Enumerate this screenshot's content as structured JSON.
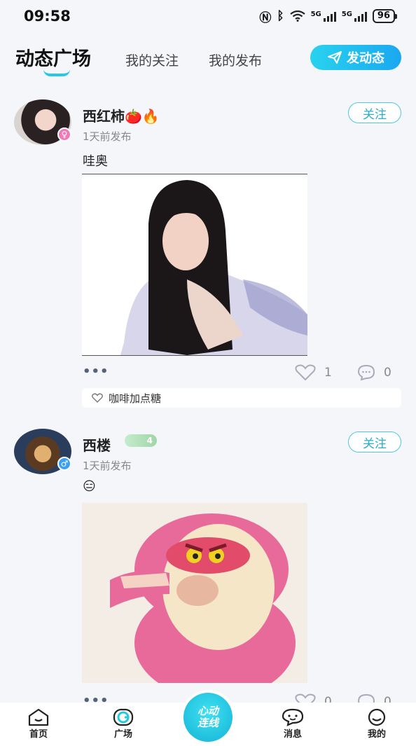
{
  "status_bar": {
    "time": "09:58",
    "net1": "5G",
    "net2": "5G",
    "battery": "96"
  },
  "tabs": {
    "active": "动态广场",
    "following": "我的关注",
    "mine": "我的发布",
    "post_button": "发动态"
  },
  "posts": [
    {
      "username": "西红柿🍅🔥",
      "time": "1天前发布",
      "content": "哇奥",
      "follow_label": "关注",
      "likes": "1",
      "comments": "0",
      "comment_preview": "咖啡加点糖",
      "gender": "female"
    },
    {
      "username": "西楼",
      "level": "4",
      "time": "1天前发布",
      "content": "😑",
      "follow_label": "关注",
      "likes": "0",
      "comments": "0",
      "gender": "male"
    }
  ],
  "bottom_nav": {
    "home": "首页",
    "square": "广场",
    "center_line1": "心动",
    "center_line2": "连线",
    "messages": "消息",
    "me": "我的"
  },
  "colors": {
    "accent": "#27c7e8",
    "female": "#f07ab8",
    "male": "#3aa0f0"
  }
}
